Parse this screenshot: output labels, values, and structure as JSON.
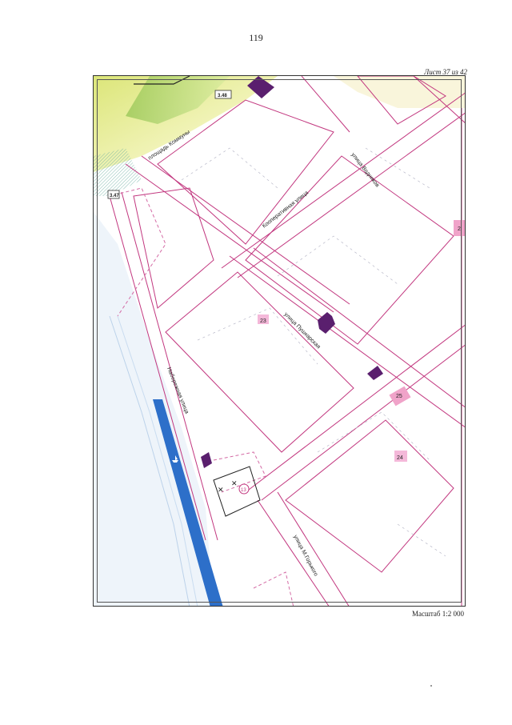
{
  "page": {
    "number": "119"
  },
  "sheet": {
    "label": "Лист 37 из 42"
  },
  "scale": {
    "label": "Масштаб 1:2 000"
  },
  "map": {
    "streets": {
      "kommuny_square": "площадь Коммуны",
      "vodnikov": "улица Водников",
      "kooperativnaya": "Кооперативная улица",
      "pushkarskaya": "улица Пушкарская",
      "naberezhnaya": "Набережная улица",
      "m_gorkogo": "улица М.Горького"
    },
    "markers": {
      "m348": "3.48",
      "m347": "3.47",
      "m23": "23",
      "m24": "24",
      "m25": "25",
      "m2": "2",
      "m13": "13"
    }
  }
}
